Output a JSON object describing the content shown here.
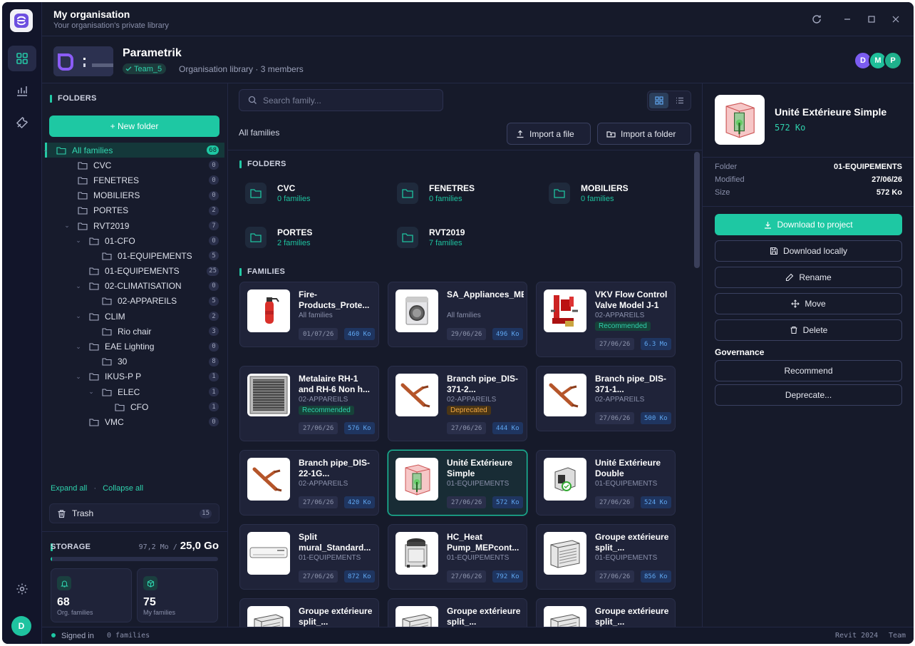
{
  "app": {
    "title": "My organisation",
    "subtitle": "Your organisation's private library"
  },
  "org": {
    "name": "Parametrik",
    "team": "Team_5",
    "meta": "Organisation library · 3 members",
    "members": [
      {
        "initial": "D",
        "color": "#7b5cf0"
      },
      {
        "initial": "M",
        "color": "#1fbf9a"
      },
      {
        "initial": "P",
        "color": "#1fb08c"
      }
    ]
  },
  "sidebar": {
    "folders_label": "FOLDERS",
    "new_folder": "+ New folder",
    "tree": [
      {
        "label": "All families",
        "count": "68",
        "level": 0,
        "chev": true
      },
      {
        "label": "CVC",
        "count": "0",
        "level": 1,
        "chev": false
      },
      {
        "label": "FENETRES",
        "count": "0",
        "level": 1,
        "chev": false
      },
      {
        "label": "MOBILIERS",
        "count": "0",
        "level": 1,
        "chev": false
      },
      {
        "label": "PORTES",
        "count": "2",
        "level": 1,
        "chev": false
      },
      {
        "label": "RVT2019",
        "count": "7",
        "level": 1,
        "chev": true
      },
      {
        "label": "01-CFO",
        "count": "0",
        "level": 2,
        "chev": true
      },
      {
        "label": "01-EQUIPEMENTS",
        "count": "5",
        "level": 3,
        "chev": false
      },
      {
        "label": "01-EQUIPEMENTS",
        "count": "25",
        "level": 2,
        "chev": false
      },
      {
        "label": "02-CLIMATISATION",
        "count": "0",
        "level": 2,
        "chev": true
      },
      {
        "label": "02-APPAREILS",
        "count": "5",
        "level": 3,
        "chev": false
      },
      {
        "label": "CLIM",
        "count": "2",
        "level": 2,
        "chev": true
      },
      {
        "label": "Rio chair",
        "count": "3",
        "level": 3,
        "chev": false
      },
      {
        "label": "EAE Lighting",
        "count": "0",
        "level": 2,
        "chev": true
      },
      {
        "label": "30",
        "count": "8",
        "level": 3,
        "chev": false
      },
      {
        "label": "IKUS-P P",
        "count": "1",
        "level": 2,
        "chev": true
      },
      {
        "label": "ELEC",
        "count": "1",
        "level": 3,
        "chev": true
      },
      {
        "label": "CFO",
        "count": "1",
        "level": 4,
        "chev": false
      },
      {
        "label": "VMC",
        "count": "0",
        "level": 2,
        "chev": false
      }
    ],
    "expand_all": "Expand all",
    "collapse_all": "Collapse all",
    "trash": "Trash",
    "trash_count": "15"
  },
  "storage": {
    "label": "STORAGE",
    "used": "97,2 Mo /",
    "total": "25,0 Go",
    "used_fraction": 0.004,
    "org_families": "68",
    "org_label": "Org. families",
    "my_families": "75",
    "my_label": "My families"
  },
  "main": {
    "search_placeholder": "Search family...",
    "breadcrumb": "All families",
    "import_file": "Import a file",
    "import_folder": "Import a folder",
    "folders_label": "FOLDERS",
    "families_label": "FAMILIES",
    "folders": [
      {
        "name": "CVC",
        "sub": "0 families"
      },
      {
        "name": "FENETRES",
        "sub": "0 families"
      },
      {
        "name": "MOBILIERS",
        "sub": "0 families"
      },
      {
        "name": "PORTES",
        "sub": "2 families"
      },
      {
        "name": "RVT2019",
        "sub": "7 families"
      }
    ],
    "families": [
      {
        "name": "Fire-Products_Prote...",
        "folder": "All families",
        "badge": "",
        "date": "01/07/26",
        "size": "460 Ko",
        "thumb": "extinguisher"
      },
      {
        "name": "SA_Appliances_MEPcontent_Uns...",
        "folder": "All families",
        "badge": "",
        "date": "29/06/26",
        "size": "496 Ko",
        "thumb": "washer"
      },
      {
        "name": "VKV Flow Control Valve Model J-1",
        "folder": "02-APPAREILS",
        "badge": "Recommended",
        "date": "27/06/26",
        "size": "6.3 Mo",
        "thumb": "valve"
      },
      {
        "name": "Metalaire RH-1 and RH-6 Non h...",
        "folder": "02-APPAREILS",
        "badge": "Recommended",
        "date": "27/06/26",
        "size": "576 Ko",
        "thumb": "grille"
      },
      {
        "name": "Branch pipe_DIS-371-2...",
        "folder": "02-APPAREILS",
        "badge": "Deprecated",
        "date": "27/06/26",
        "size": "444 Ko",
        "thumb": "pipe"
      },
      {
        "name": "Branch pipe_DIS-371-1...",
        "folder": "02-APPAREILS",
        "badge": "",
        "date": "27/06/26",
        "size": "500 Ko",
        "thumb": "pipe"
      },
      {
        "name": "Branch pipe_DIS-22-1G...",
        "folder": "02-APPAREILS",
        "badge": "",
        "date": "27/06/26",
        "size": "420 Ko",
        "thumb": "pipe"
      },
      {
        "name": "Unité Extérieure Simple",
        "folder": "01-EQUIPEMENTS",
        "badge": "",
        "date": "27/06/26",
        "size": "572 Ko",
        "thumb": "unit"
      },
      {
        "name": "Unité Extérieure Double",
        "folder": "01-EQUIPEMENTS",
        "badge": "",
        "date": "27/06/26",
        "size": "524 Ko",
        "thumb": "double"
      },
      {
        "name": "Split mural_Standard...",
        "folder": "01-EQUIPEMENTS",
        "badge": "",
        "date": "27/06/26",
        "size": "872 Ko",
        "thumb": "split"
      },
      {
        "name": "HC_Heat Pump_MEPcont...",
        "folder": "01-EQUIPEMENTS",
        "badge": "",
        "date": "27/06/26",
        "size": "792 Ko",
        "thumb": "heatpump"
      },
      {
        "name": "Groupe extérieure split_...",
        "folder": "01-EQUIPEMENTS",
        "badge": "",
        "date": "27/06/26",
        "size": "856 Ko",
        "thumb": "outdoor"
      },
      {
        "name": "Groupe extérieure split_...",
        "folder": "",
        "badge": "",
        "date": "",
        "size": "",
        "thumb": "outdoor"
      },
      {
        "name": "Groupe extérieure split_...",
        "folder": "",
        "badge": "",
        "date": "",
        "size": "",
        "thumb": "outdoor"
      },
      {
        "name": "Groupe extérieure split_...",
        "folder": "",
        "badge": "",
        "date": "",
        "size": "",
        "thumb": "outdoor"
      }
    ],
    "selected_index": 7
  },
  "detail": {
    "name": "Unité Extérieure Simple",
    "size": "572 Ko",
    "meta": [
      {
        "k": "Folder",
        "v": "01-EQUIPEMENTS"
      },
      {
        "k": "Modified",
        "v": "27/06/26"
      },
      {
        "k": "Size",
        "v": "572 Ko"
      }
    ],
    "download_project": "Download to project",
    "download_local": "Download locally",
    "rename": "Rename",
    "move": "Move",
    "delete": "Delete",
    "governance": "Governance",
    "recommend": "Recommend",
    "deprecate": "Deprecate..."
  },
  "status": {
    "signed": "Signed in",
    "families": "0 families",
    "revit": "Revit 2024",
    "team": "Team"
  },
  "colors": {
    "accent": "#1ec8a3",
    "deprecated": "#f0a742",
    "size_badge": "#5fa6f0"
  }
}
